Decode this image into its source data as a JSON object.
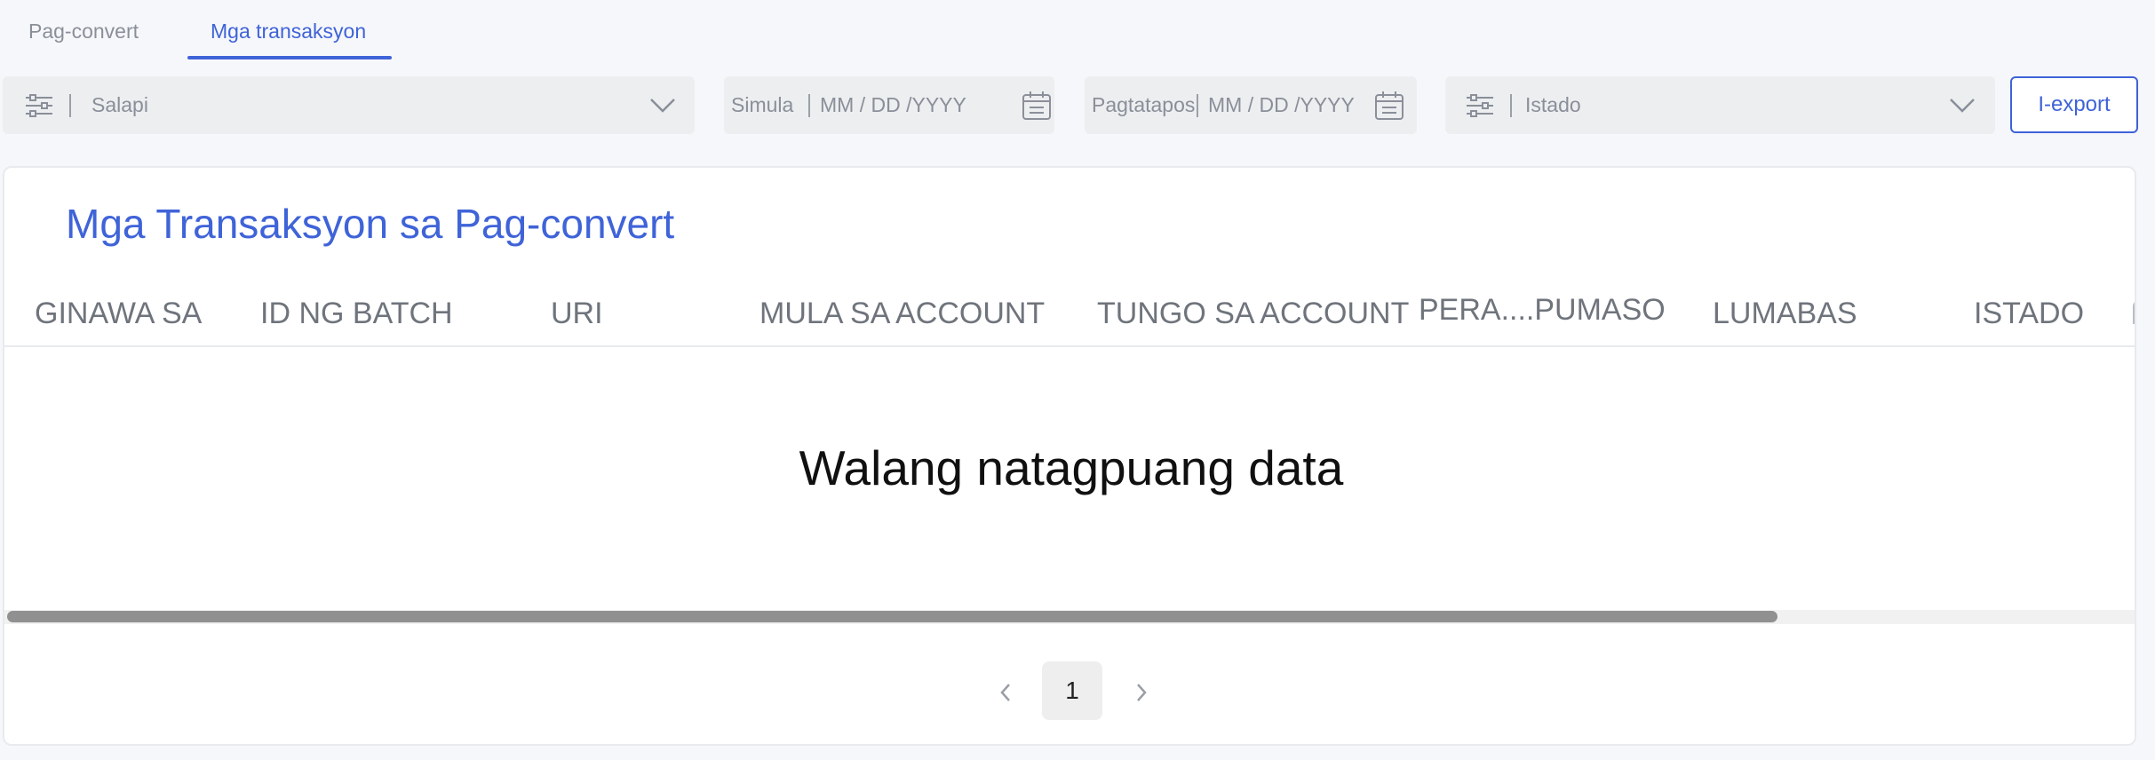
{
  "tabs": [
    {
      "label": "Pag-convert",
      "active": false
    },
    {
      "label": "Mga transaksyon",
      "active": true
    }
  ],
  "filters": {
    "currency": {
      "placeholder": "Salapi",
      "icon": "sliders-icon"
    },
    "start_date": {
      "label": "Simula",
      "placeholder": "MM / DD /YYYY",
      "icon": "calendar-icon"
    },
    "end_date": {
      "label": "Pagtatapos",
      "placeholder": "MM / DD /YYYY",
      "icon": "calendar-icon"
    },
    "status": {
      "placeholder": "Istado",
      "icon": "sliders-icon"
    },
    "export_label": "I-export"
  },
  "card": {
    "title": "Mga Transaksyon sa Pag-convert",
    "columns": [
      "GINAWA SA",
      "ID NG BATCH",
      "URI",
      "MULA SA ACCOUNT",
      "TUNGO SA ACCOUNT",
      "PERA....PUMASO",
      "LUMABAS",
      "ISTADO"
    ],
    "rows": [],
    "empty_message": "Walang natagpuang data"
  },
  "pagination": {
    "current_page": "1"
  },
  "colors": {
    "accent": "#3f63d8",
    "filter_bg": "#eceef0",
    "page_bg": "#f6f7fa"
  }
}
